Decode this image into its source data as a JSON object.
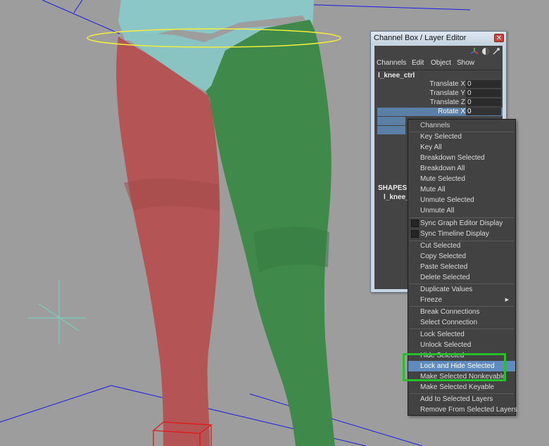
{
  "viewport": {
    "name": "3D viewport",
    "colors": {
      "background": "#9d9d9d",
      "torso": "#8bc7c6",
      "left_leg": "#b45454",
      "right_leg": "#3f8a4b",
      "selection_curve": "#f2ef3a",
      "grid_line": "#1a1ae6"
    }
  },
  "channel_box": {
    "title": "Channel Box / Layer Editor",
    "close_glyph": "✕",
    "menu": [
      "Channels",
      "Edit",
      "Object",
      "Show"
    ],
    "node_name": "l_knee_ctrl",
    "attributes": [
      {
        "label": "Translate X",
        "value": "0",
        "selected": false
      },
      {
        "label": "Translate Y",
        "value": "0",
        "selected": false
      },
      {
        "label": "Translate Z",
        "value": "0",
        "selected": false
      },
      {
        "label": "Rotate X",
        "value": "0",
        "selected": true
      }
    ],
    "shapes_label": "SHAPES",
    "shape_node": "l_knee_",
    "icons": [
      "axis-icon",
      "display-icon",
      "pin-icon"
    ]
  },
  "context_menu": {
    "header": "Channels",
    "items": [
      "Key Selected",
      "Key All",
      "Breakdown Selected",
      "Breakdown All",
      "Mute Selected",
      "Mute All",
      "Unmute Selected",
      "Unmute All",
      "Sync Graph Editor Display",
      "Sync Timeline Display",
      "Cut Selected",
      "Copy Selected",
      "Paste Selected",
      "Delete Selected",
      "Duplicate Values",
      "Freeze",
      "Break Connections",
      "Select Connection",
      "Lock Selected",
      "Unlock Selected",
      "Hide Selected",
      "Lock and Hide Selected",
      "Make Selected Nonkeyable",
      "Make Selected Keyable",
      "Add to Selected Layers",
      "Remove From Selected Layers"
    ],
    "highlighted": "Lock and Hide Selected",
    "submenu_arrow": "▶",
    "highlight_color": "#5f8bbe",
    "annotation_color": "#27c02a"
  }
}
